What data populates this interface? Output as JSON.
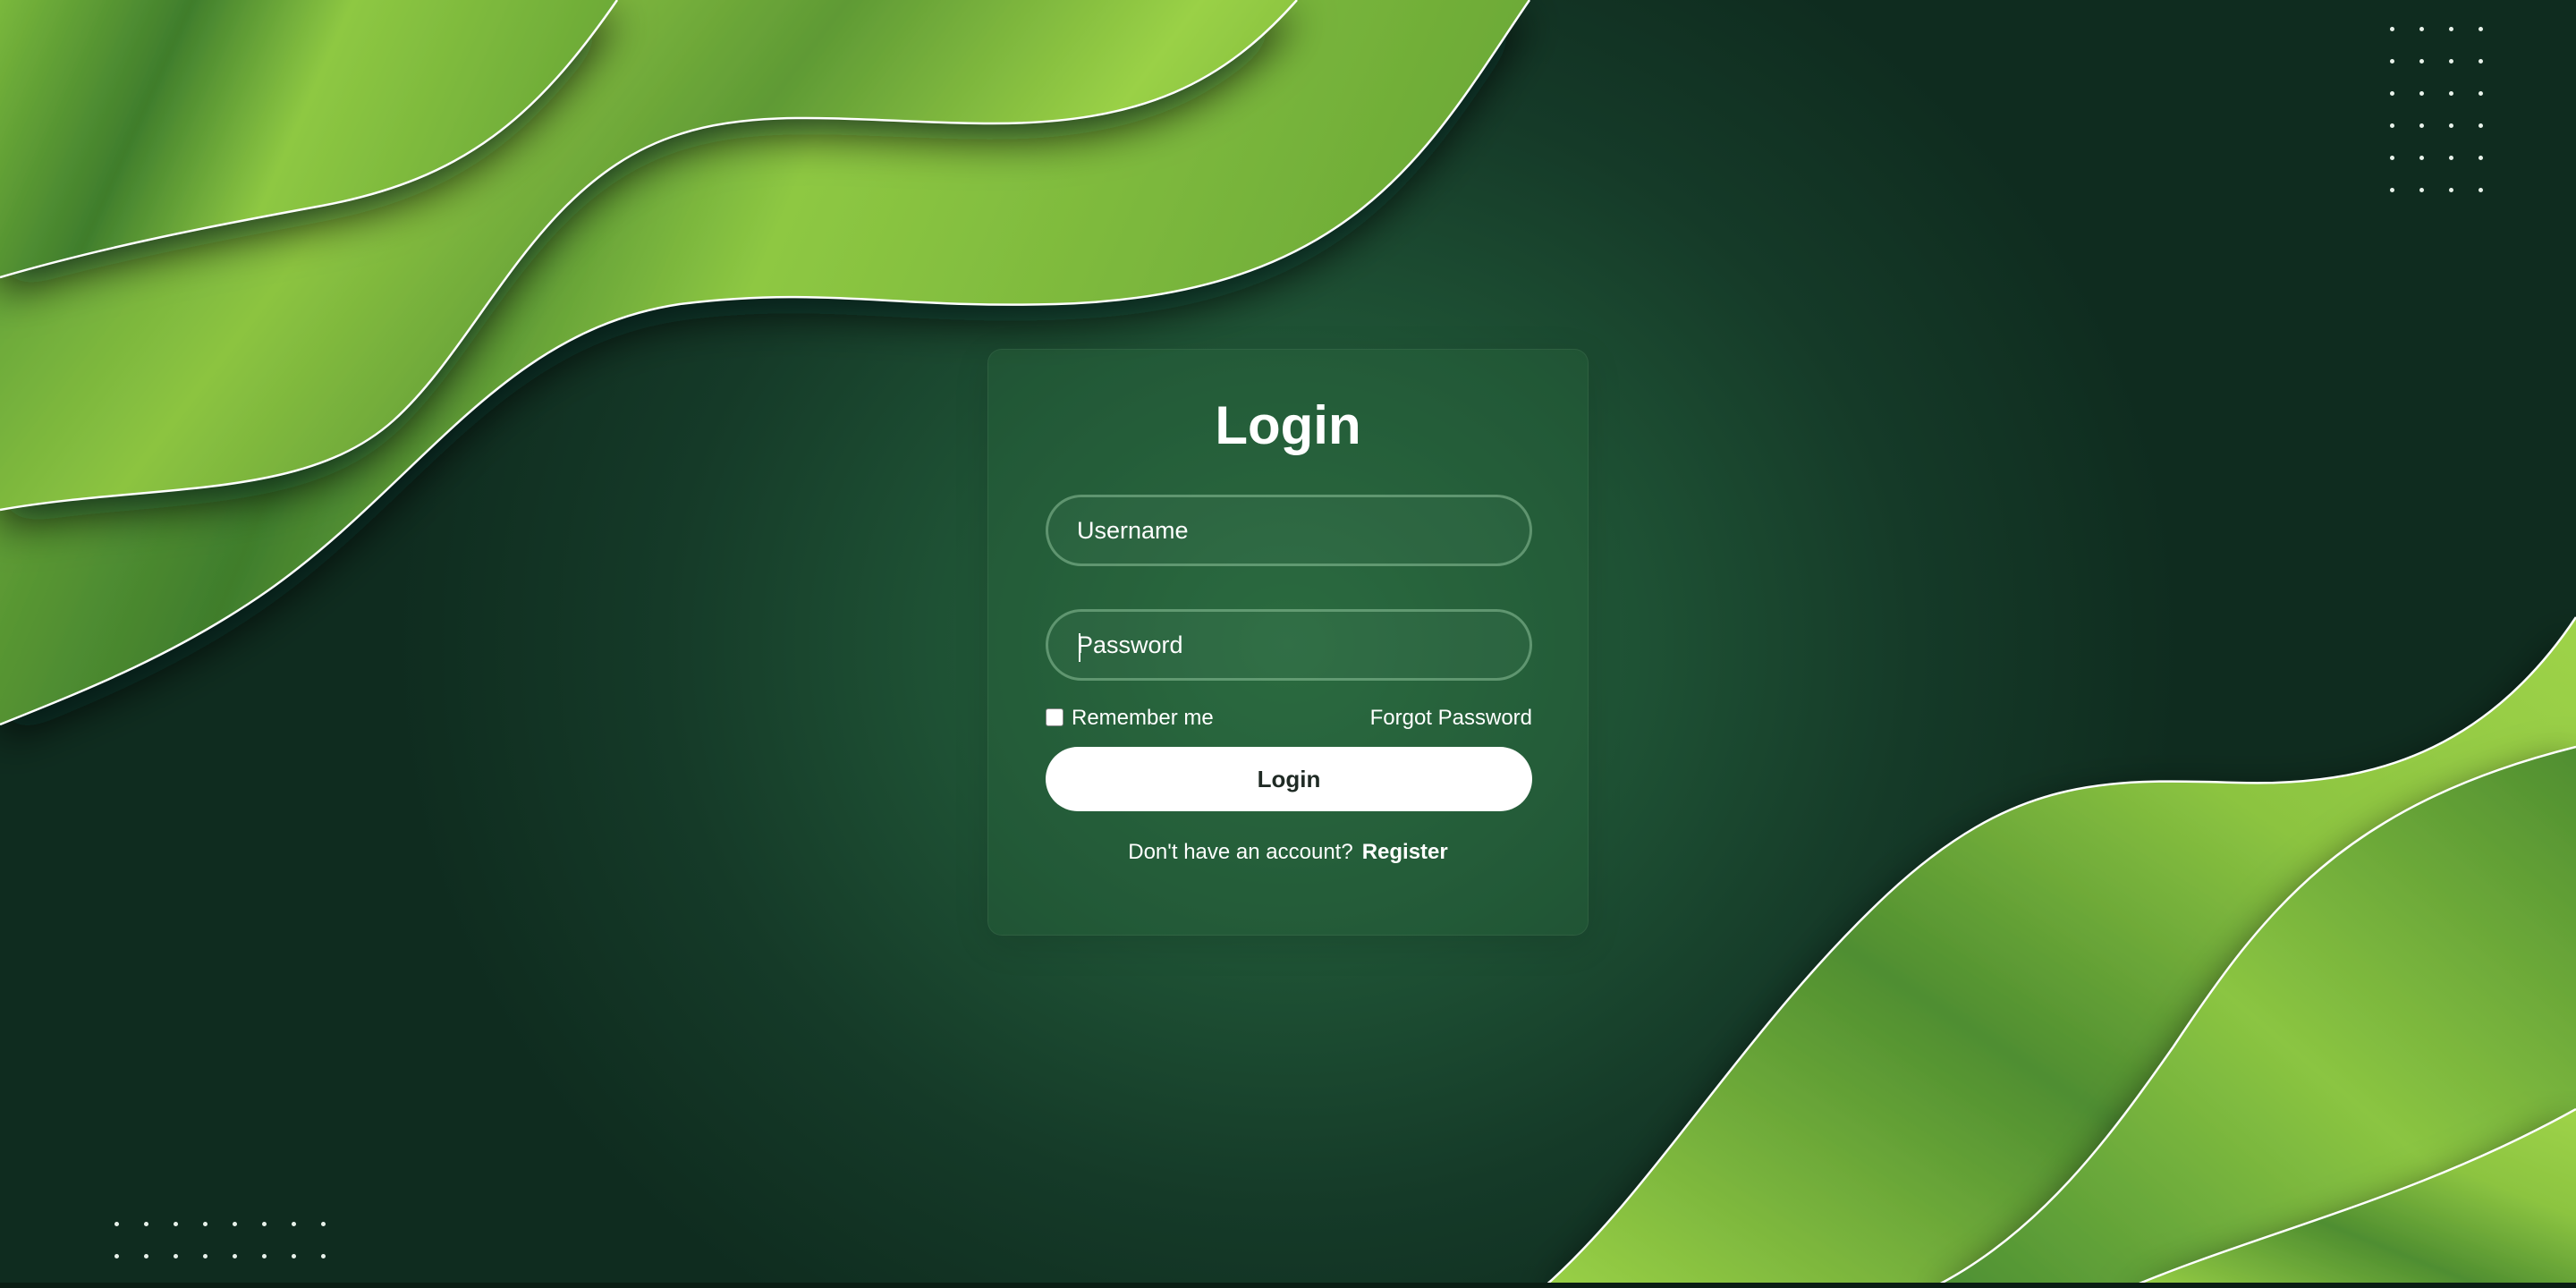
{
  "login": {
    "title": "Login",
    "username_placeholder": "Username",
    "username_value": "",
    "password_placeholder": "Password",
    "password_value": "",
    "remember_label": "Remember me",
    "remember_checked": false,
    "forgot_label": "Forgot Password",
    "submit_label": "Login",
    "register_prompt": "Don't have an account?",
    "register_label": "Register"
  },
  "theme": {
    "background_dark": "#0f2c1f",
    "background_center": "#2a6a40",
    "wave_light": "#94cc44",
    "wave_dark": "#3f7d2c",
    "button_bg": "#ffffff",
    "text": "#ffffff"
  }
}
